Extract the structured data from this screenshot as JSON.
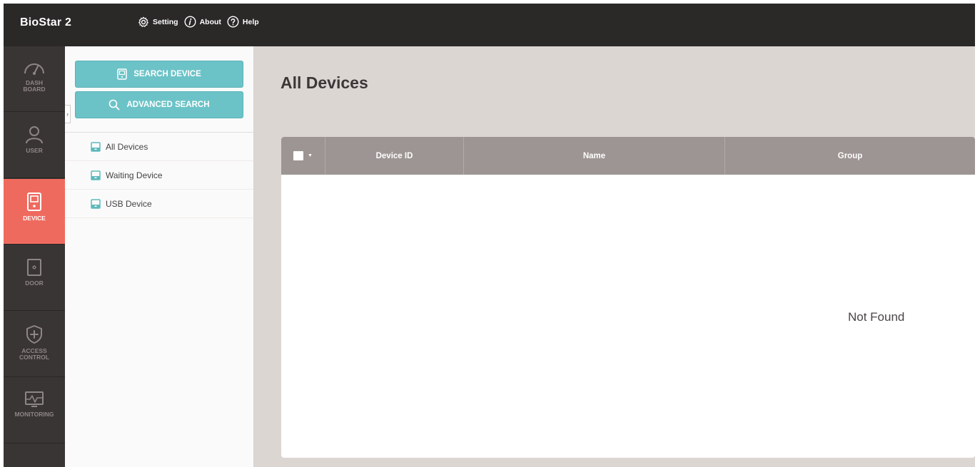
{
  "app": {
    "title": "BioStar 2"
  },
  "topnav": [
    {
      "label": "Setting",
      "icon": "gear-icon"
    },
    {
      "label": "About",
      "icon": "info-icon"
    },
    {
      "label": "Help",
      "icon": "help-icon"
    }
  ],
  "leftnav": [
    {
      "label": "DASH\nBOARD",
      "icon": "gauge-icon",
      "active": false
    },
    {
      "label": "USER",
      "icon": "user-icon",
      "active": false
    },
    {
      "label": "DEVICE",
      "icon": "device-icon",
      "active": true
    },
    {
      "label": "DOOR",
      "icon": "door-icon",
      "active": false
    },
    {
      "label": "ACCESS\nCONTROL",
      "icon": "access-control-icon",
      "active": false
    },
    {
      "label": "MONITORING",
      "icon": "monitoring-icon",
      "active": false
    }
  ],
  "sidepanel": {
    "search_button": "SEARCH DEVICE",
    "advanced_search_button": "ADVANCED SEARCH",
    "collapse_toggle": "›",
    "tree": [
      {
        "label": "All Devices"
      },
      {
        "label": "Waiting Device"
      },
      {
        "label": "USB Device"
      }
    ]
  },
  "main": {
    "title": "All Devices",
    "table": {
      "columns": [
        "Device ID",
        "Name",
        "Group"
      ],
      "caret": "▼",
      "empty_message": "Not Found",
      "rows": []
    }
  },
  "colors": {
    "topbar": "#2b2828",
    "leftnav": "#3a3535",
    "active_nav": "#ef6a5e",
    "button": "#6cc3c7",
    "table_header": "#9d9593",
    "content_bg": "#dcd6d3"
  }
}
